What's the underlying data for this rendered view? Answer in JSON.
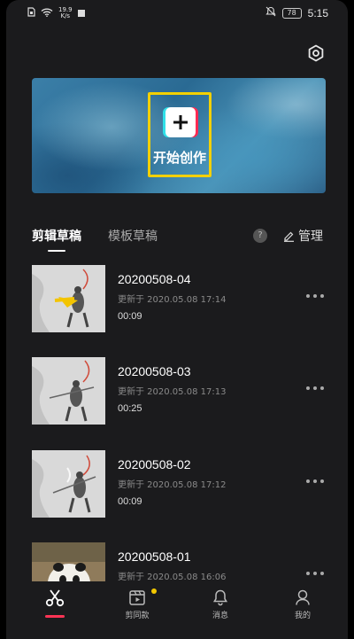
{
  "status_bar": {
    "speed_value": "19.9",
    "speed_unit": "K/s",
    "battery": "78",
    "time": "5:15"
  },
  "banner": {
    "start_label": "开始创作"
  },
  "tabs": {
    "active": "剪辑草稿",
    "inactive": "模板草稿",
    "help": "?",
    "manage": "管理"
  },
  "drafts": [
    {
      "title": "20200508-04",
      "updated": "更新于 2020.05.08 17:14",
      "duration": "00:09"
    },
    {
      "title": "20200508-03",
      "updated": "更新于 2020.05.08 17:13",
      "duration": "00:25"
    },
    {
      "title": "20200508-02",
      "updated": "更新于 2020.05.08 17:12",
      "duration": "00:09"
    },
    {
      "title": "20200508-01",
      "updated": "更新于 2020.05.08 16:06",
      "duration": ""
    }
  ],
  "bottom_nav": {
    "edit": "",
    "template": "剪同款",
    "messages": "消息",
    "profile": "我的"
  },
  "colors": {
    "background": "#1b1b1d",
    "accent_red": "#ff3455",
    "frame_yellow": "#f3d000",
    "notification_dot": "#f3c800"
  },
  "icons": {
    "settings": "gear-icon",
    "edit_tab": "scissors-icon",
    "template_tab": "video-template-icon",
    "messages_tab": "bell-icon",
    "profile_tab": "person-icon",
    "manage": "pencil-icon",
    "more": "more-dots-icon"
  }
}
